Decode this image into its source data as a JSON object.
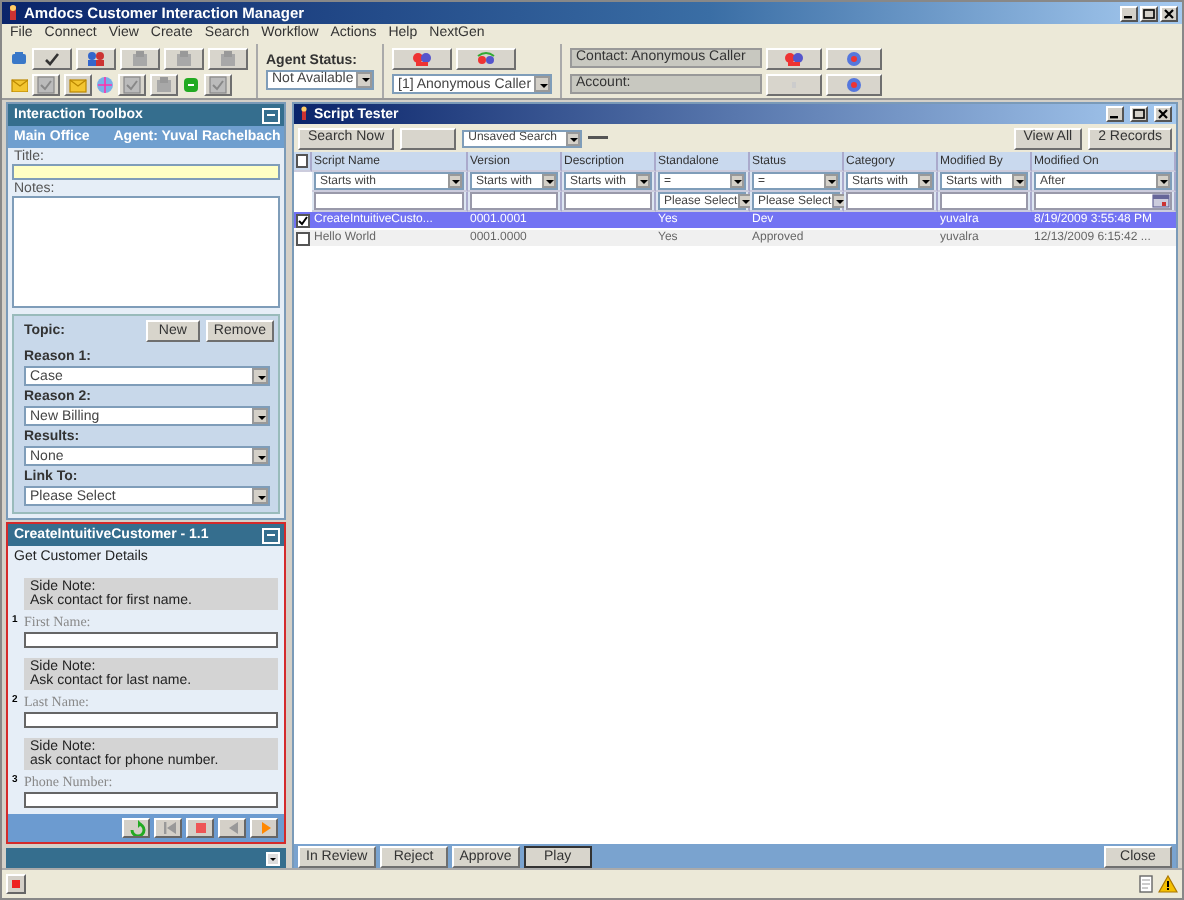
{
  "window": {
    "title": "Amdocs Customer Interaction Manager"
  },
  "menu": [
    "File",
    "Connect",
    "View",
    "Create",
    "Search",
    "Workflow",
    "Actions",
    "Help",
    "NextGen"
  ],
  "toolbar": {
    "agent_status_label": "Agent Status:",
    "agent_status": "Not Available",
    "caller": "[1] Anonymous Caller",
    "contact": "Contact: Anonymous Caller",
    "account": "Account:"
  },
  "interaction_toolbox": {
    "title": "Interaction Toolbox",
    "office": "Main Office",
    "agent": "Agent: Yuval Rachelbach",
    "title_label": "Title:",
    "notes_label": "Notes:",
    "topic_label": "Topic:",
    "topic_buttons": [
      "New",
      "Remove"
    ],
    "fields": [
      {
        "label": "Reason 1:",
        "value": "Case"
      },
      {
        "label": "Reason 2:",
        "value": "New Billing"
      },
      {
        "label": "Results:",
        "value": "None"
      },
      {
        "label": "Link To:",
        "value": "Please Select"
      }
    ]
  },
  "script_panel": {
    "title": "CreateIntuitiveCustomer - 1.1",
    "heading": "Get Customer Details",
    "steps": [
      {
        "number": "1",
        "note_title": "Side Note:",
        "note": "Ask contact for first name.",
        "label": "First Name:"
      },
      {
        "number": "2",
        "note_title": "Side Note:",
        "note": "Ask contact for last name.",
        "label": "Last Name:"
      },
      {
        "number": "3",
        "note_title": "Side Note:",
        "note": "ask contact for phone number.",
        "label": "Phone Number:"
      }
    ]
  },
  "script_tester": {
    "title": "Script Tester",
    "search_button": "Search Now",
    "saved_search": "Unsaved Search",
    "view_all": "View All",
    "records": "2 Records",
    "all_checked": false,
    "columns": [
      {
        "name": "Script Name",
        "filter": "Starts with",
        "filter2": {
          "kind": "text"
        }
      },
      {
        "name": "Version",
        "filter": "Starts with",
        "filter2": {
          "kind": "text"
        }
      },
      {
        "name": "Description",
        "filter": "Starts with",
        "filter2": {
          "kind": "text"
        }
      },
      {
        "name": "Standalone",
        "filter": "=",
        "filter2": {
          "kind": "select",
          "value": "Please Select"
        }
      },
      {
        "name": "Status",
        "filter": "=",
        "filter2": {
          "kind": "select",
          "value": "Please Select"
        }
      },
      {
        "name": "Category",
        "filter": "Starts with",
        "filter2": {
          "kind": "text"
        }
      },
      {
        "name": "Modified By",
        "filter": "Starts with",
        "filter2": {
          "kind": "text"
        }
      },
      {
        "name": "Modified On",
        "filter": "After",
        "filter2": {
          "kind": "date"
        }
      }
    ],
    "rows": [
      {
        "checked": true,
        "selected": true,
        "cells": [
          "CreateIntuitiveCusto...",
          "0001.0001",
          null,
          "Yes",
          "Dev",
          null,
          "yuvalra",
          "8/19/2009 3:55:48 PM"
        ]
      },
      {
        "checked": false,
        "selected": false,
        "cells": [
          "Hello World",
          "0001.0000",
          null,
          "Yes",
          "Approved",
          null,
          "yuvalra",
          "12/13/2009 6:15:42 ..."
        ]
      }
    ],
    "buttons": [
      {
        "label": "In Review",
        "focused": false
      },
      {
        "label": "Reject",
        "focused": false
      },
      {
        "label": "Approve",
        "focused": false
      },
      {
        "label": "Play",
        "focused": true
      }
    ],
    "close": "Close"
  }
}
